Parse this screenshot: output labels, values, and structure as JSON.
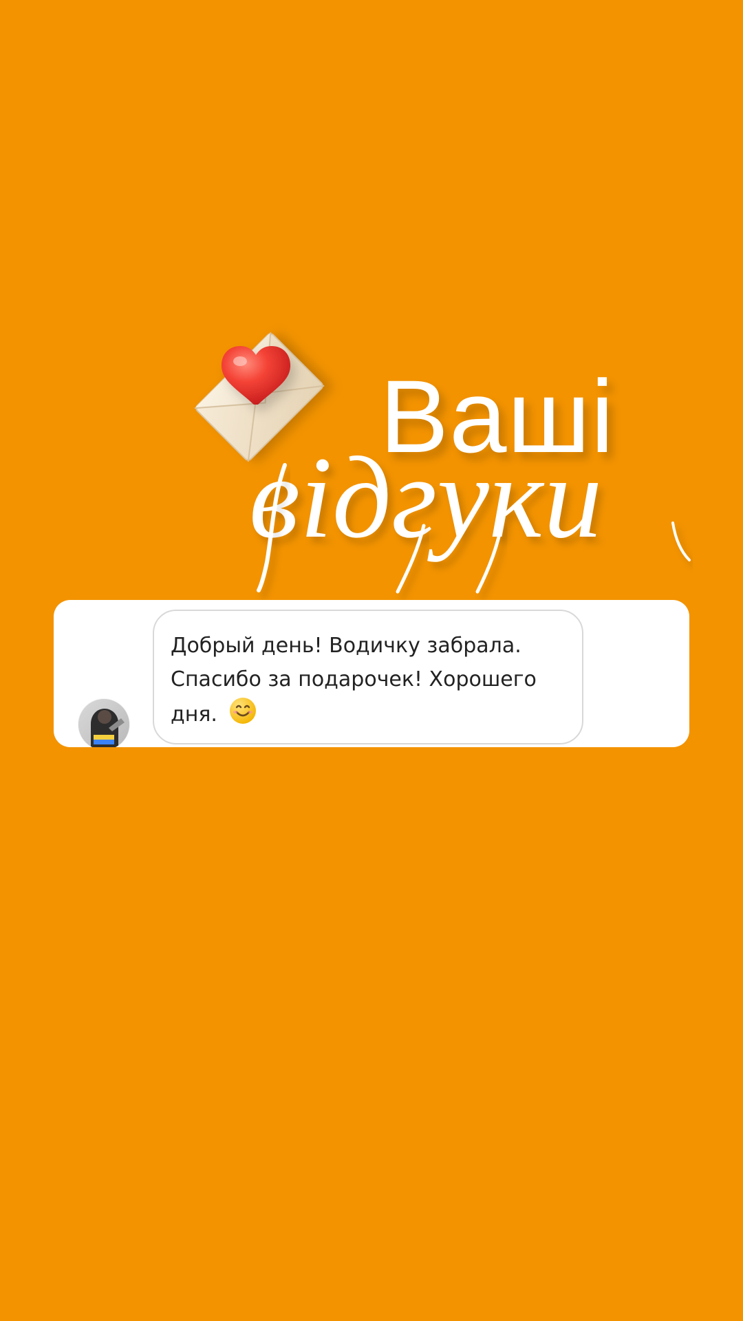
{
  "theme": {
    "background": "#F39300",
    "card_background": "#FFFFFF",
    "bubble_border": "#D8D8D8",
    "text_color": "#222222"
  },
  "header": {
    "title_main": "Ваші",
    "title_script": "відгуки",
    "icons": [
      "envelope-icon",
      "heart-icon"
    ]
  },
  "review": {
    "message_text": "Добрый день! Водичку забрала. Спасибо за подарочек! Хорошего дня.",
    "message_emoji": "😊",
    "avatar_icon": "avatar-photo"
  }
}
